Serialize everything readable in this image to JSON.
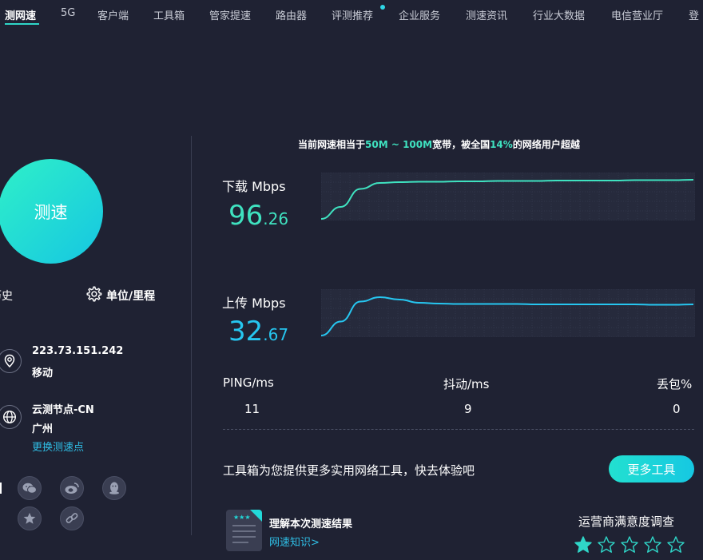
{
  "nav": {
    "items": [
      "测网速",
      "5G",
      "客户端",
      "工具箱",
      "管家提速",
      "路由器",
      "评测推荐",
      "企业服务",
      "测速资讯",
      "行业大数据",
      "电信营业厅",
      "登"
    ]
  },
  "left": {
    "speed_button": "测速",
    "history_label": "历史",
    "unit_label": "单位/里程",
    "ip": "223.73.151.242",
    "isp": "移动",
    "node_name": "云测节点-CN",
    "node_city": "广州",
    "change_node": "更换测速点"
  },
  "summary": {
    "prefix": "当前网速相当于",
    "bandwidth": "50M ~ 100M",
    "mid": "宽带，被全国",
    "percent": "14%",
    "suffix": "的网络用户超越"
  },
  "download": {
    "label": "下载 Mbps",
    "int": "96",
    "dec": ".26",
    "color": "#3fe2c0",
    "curve": [
      0.0,
      0.3,
      0.75,
      0.9,
      0.92,
      0.93,
      0.93,
      0.94,
      0.94,
      0.95,
      0.95,
      0.95,
      0.96,
      0.96,
      0.96,
      0.96,
      0.97,
      0.97,
      0.97,
      0.98
    ]
  },
  "upload": {
    "label": "上传 Mbps",
    "int": "32",
    "dec": ".67",
    "color": "#26c6f0",
    "curve": [
      0.0,
      0.35,
      0.85,
      0.96,
      0.9,
      0.82,
      0.8,
      0.79,
      0.79,
      0.79,
      0.79,
      0.78,
      0.78,
      0.78,
      0.78,
      0.78,
      0.78,
      0.77,
      0.77,
      0.78
    ]
  },
  "stats": {
    "ping_label": "PING/ms",
    "ping": "11",
    "jitter_label": "抖动/ms",
    "jitter": "9",
    "loss_label": "丢包%",
    "loss": "0"
  },
  "promo": {
    "text": "工具箱为您提供更多实用网络工具，快去体验吧",
    "button": "更多工具"
  },
  "result": {
    "title": "理解本次测速结果",
    "link": "网速知识>"
  },
  "survey": {
    "title": "运营商满意度调查",
    "rating": 1,
    "max": 5
  },
  "icons": [
    "location-icon",
    "globe-icon",
    "gear-icon",
    "wechat-icon",
    "weibo-icon",
    "qq-icon",
    "star-icon",
    "link-icon"
  ]
}
